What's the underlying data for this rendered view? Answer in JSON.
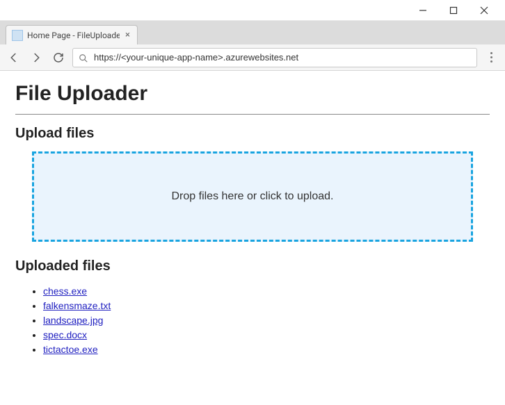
{
  "window": {
    "tab_title": "Home Page - FileUploade",
    "address_url": "https://<your-unique-app-name>.azurewebsites.net"
  },
  "page": {
    "title": "File Uploader",
    "upload_section_heading": "Upload files",
    "dropzone_text": "Drop files here or click to upload.",
    "uploaded_section_heading": "Uploaded files",
    "files": [
      "chess.exe",
      "falkensmaze.txt",
      "landscape.jpg",
      "spec.docx",
      "tictactoe.exe"
    ]
  }
}
